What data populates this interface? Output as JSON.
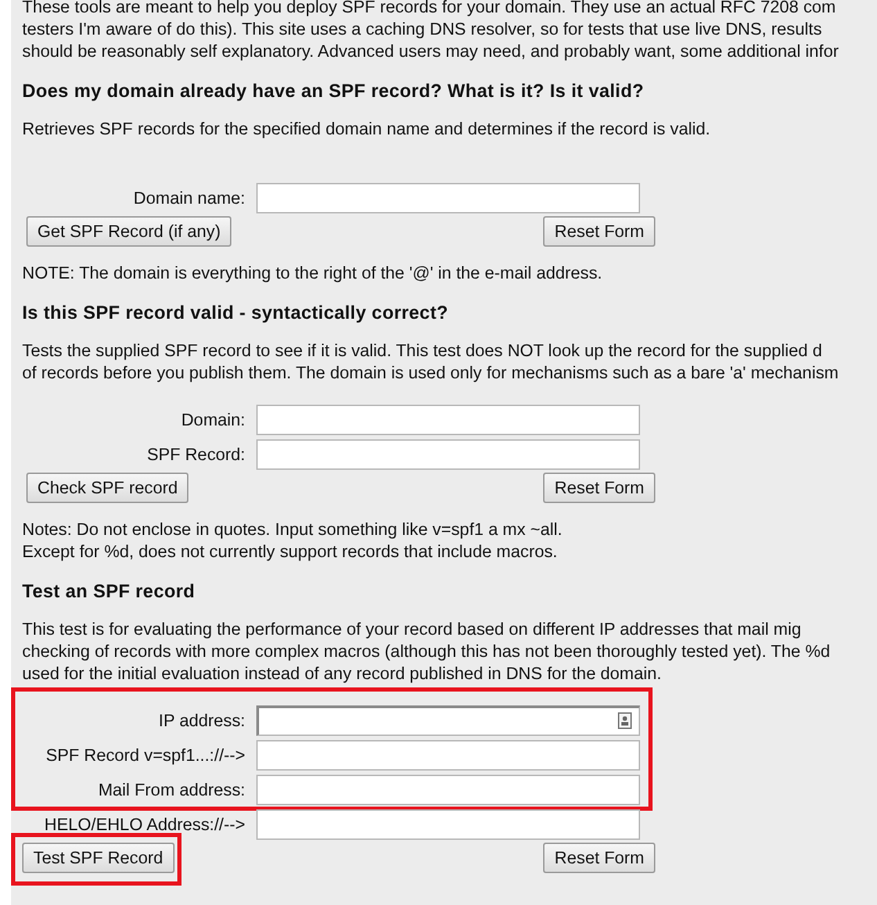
{
  "intro": {
    "lines": [
      "These tools are meant to help you deploy SPF records for your domain. They use an actual RFC 7208 com",
      "testers I'm aware of do this). This site uses a caching DNS resolver, so for tests that use live DNS, results",
      "should be reasonably self explanatory. Advanced users may need, and probably want, some additional infor"
    ]
  },
  "sections": [
    {
      "heading": "Does my domain already have an SPF record? What is it? Is it valid?",
      "description": [
        "Retrieves SPF records for the specified domain name and determines if the record is valid."
      ],
      "field_groups": [
        {
          "highlighted": false,
          "fields": [
            {
              "label": "Domain name:",
              "kind": "plain"
            }
          ]
        }
      ],
      "buttons": [
        {
          "label": "Get SPF Record (if any)",
          "highlighted": false
        },
        {
          "label": "Reset Form",
          "highlighted": false
        }
      ],
      "notes": [
        "NOTE: The domain is everything to the right of the '@' in the e-mail address."
      ]
    },
    {
      "heading": "Is this SPF record valid - syntactically correct?",
      "description": [
        "Tests the supplied SPF record to see if it is valid. This test does NOT look up the record for the supplied d",
        "of records before you publish them. The domain is used only for mechanisms such as a bare 'a' mechanism"
      ],
      "field_groups": [
        {
          "highlighted": false,
          "fields": [
            {
              "label": "Domain:",
              "kind": "plain"
            },
            {
              "label": "SPF Record:",
              "kind": "plain"
            }
          ]
        }
      ],
      "buttons": [
        {
          "label": "Check SPF record",
          "highlighted": false
        },
        {
          "label": "Reset Form",
          "highlighted": false
        }
      ],
      "notes": [
        "Notes: Do not enclose in quotes. Input something like v=spf1 a mx ~all.",
        "Except for %d, does not currently support records that include macros."
      ]
    },
    {
      "heading": "Test an SPF record",
      "description": [
        "This test is for evaluating the performance of your record based on different IP addresses that mail mig",
        "checking of records with more complex macros (although this has not been thoroughly tested yet). The %d",
        "used for the initial evaluation instead of any record published in DNS for the domain."
      ],
      "field_groups": [
        {
          "highlighted": true,
          "fields": [
            {
              "label": "IP address:",
              "kind": "contact"
            },
            {
              "label": "SPF Record v=spf1...://-->",
              "kind": "plain"
            },
            {
              "label": "Mail From address:",
              "kind": "plain"
            }
          ]
        },
        {
          "highlighted": false,
          "fields": [
            {
              "label": "HELO/EHLO Address://-->",
              "kind": "plain"
            }
          ]
        }
      ],
      "buttons": [
        {
          "label": "Test SPF Record",
          "highlighted": true
        },
        {
          "label": "Reset Form",
          "highlighted": false
        }
      ]
    }
  ]
}
